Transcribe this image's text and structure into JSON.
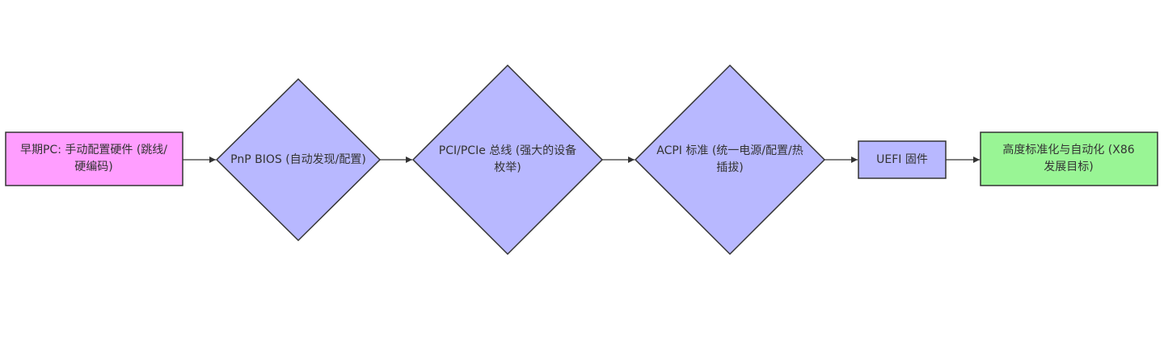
{
  "flowchart": {
    "nodes": [
      {
        "id": "early",
        "text": "早期PC: 手动配置硬件 (跳线/硬编码)",
        "shape": "rect",
        "color": "#ff9eff"
      },
      {
        "id": "pnp",
        "text": "PnP BIOS (自动发现/配置)",
        "shape": "diamond",
        "color": "#b8b8ff"
      },
      {
        "id": "pci",
        "text": "PCI/PCIe 总线 (强大的设备枚举)",
        "shape": "diamond",
        "color": "#b8b8ff"
      },
      {
        "id": "acpi",
        "text": "ACPI 标准 (统一电源/配置/热插拔)",
        "shape": "diamond",
        "color": "#b8b8ff"
      },
      {
        "id": "uefi",
        "text": "UEFI 固件",
        "shape": "rect",
        "color": "#b8b8ff"
      },
      {
        "id": "goal",
        "text": "高度标准化与自动化 (X86发展目标)",
        "shape": "rect",
        "color": "#99f595"
      }
    ],
    "edges": [
      {
        "from": "early",
        "to": "pnp"
      },
      {
        "from": "pnp",
        "to": "pci"
      },
      {
        "from": "pci",
        "to": "acpi"
      },
      {
        "from": "acpi",
        "to": "uefi"
      },
      {
        "from": "uefi",
        "to": "goal"
      }
    ]
  }
}
